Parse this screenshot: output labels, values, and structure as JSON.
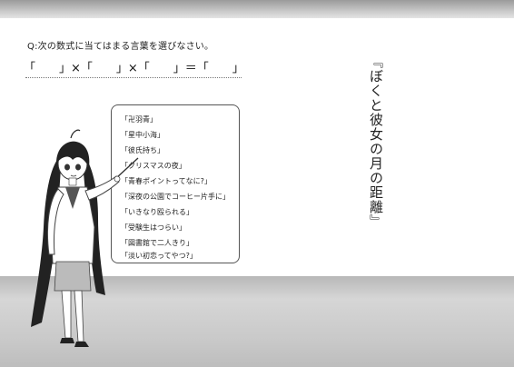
{
  "question": "Q:次の数式に当てはまる言葉を選びなさい。",
  "formula": "「　　」×「　　」×「　　」＝「　　」",
  "title": "『ぼくと彼女の月の距離』",
  "options": [
    "「卍羽青」",
    "「星中小海」",
    "「彼氏持ち」",
    "「クリスマスの夜」",
    "「青春ポイントってなに?」",
    "「深夜の公園でコーヒー片手に」",
    "「いきなり殴られる」",
    "「受験生はつらい」",
    "「図書館で二人きり」",
    "「淡い初恋ってやつ?」"
  ]
}
